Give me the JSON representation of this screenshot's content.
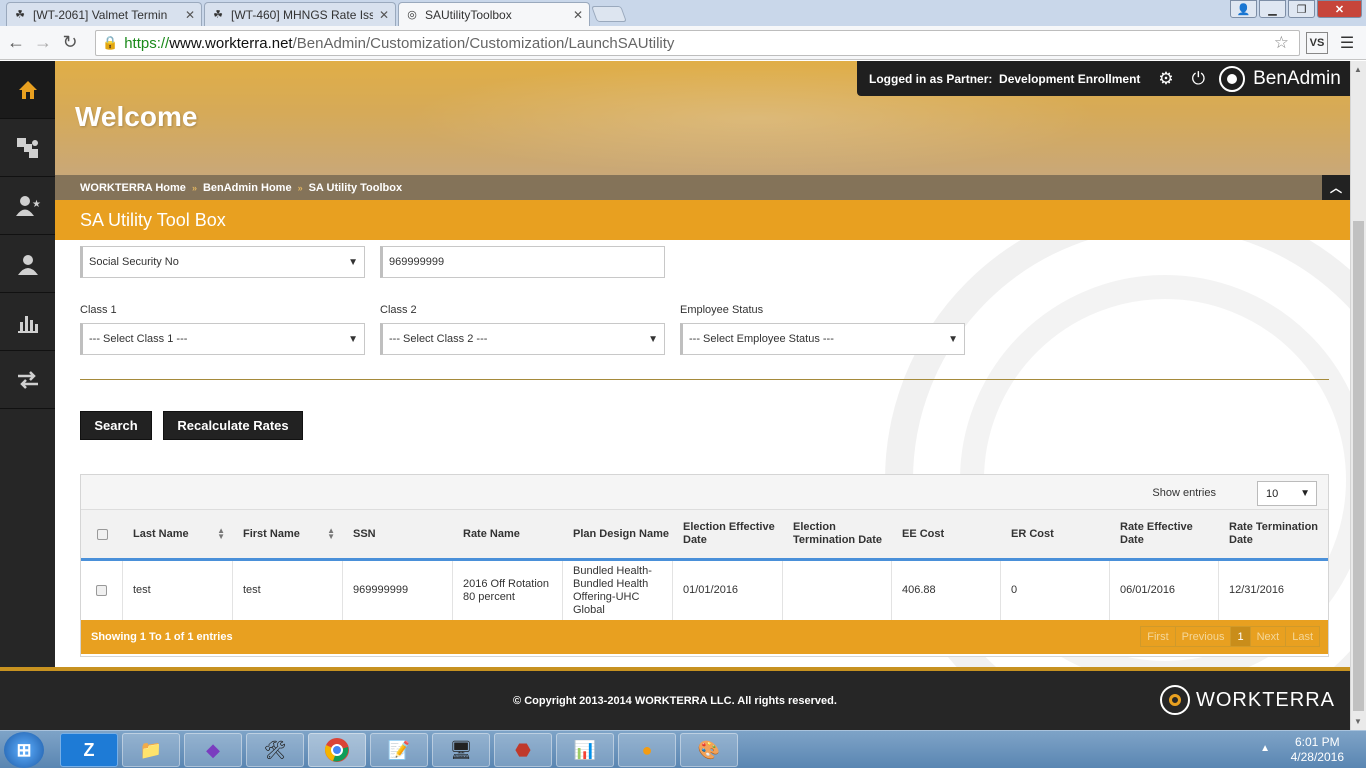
{
  "browser": {
    "tabs": [
      {
        "label": "[WT-2061] Valmet Termin",
        "active": false
      },
      {
        "label": "[WT-460] MHNGS Rate Iss",
        "active": false
      },
      {
        "label": "SAUtilityToolbox",
        "active": true
      }
    ],
    "url_https": "https://",
    "url_host": "www.workterra.net",
    "url_path": "/BenAdmin/Customization/Customization/LaunchSAUtility",
    "ext_label": "VS"
  },
  "header": {
    "welcome": "Welcome",
    "logged_in_prefix": "Logged in as",
    "partner_label": "Partner:",
    "partner_name": "Development Enrollment",
    "brand": "BenAdmin"
  },
  "breadcrumb": [
    "WORKTERRA Home",
    "BenAdmin Home",
    "SA Utility Toolbox"
  ],
  "section_title": "SA Utility Tool Box",
  "filters": {
    "search_type": "Social Security No",
    "search_value": "969999999",
    "class1_label": "Class 1",
    "class1_value": "--- Select Class 1 ---",
    "class2_label": "Class 2",
    "class2_value": "--- Select Class 2 ---",
    "status_label": "Employee Status",
    "status_value": "--- Select Employee Status ---"
  },
  "actions": {
    "search": "Search",
    "recalc": "Recalculate Rates"
  },
  "table": {
    "show_entries_label": "Show entries",
    "entries_value": "10",
    "columns": [
      "Last Name",
      "First Name",
      "SSN",
      "Rate Name",
      "Plan Design Name",
      "Election Effective Date",
      "Election Termination Date",
      "EE Cost",
      "ER Cost",
      "Rate Effective Date",
      "Rate Termination Date"
    ],
    "rows": [
      {
        "last": "test",
        "first": "test",
        "ssn": "969999999",
        "rate_name": "2016 Off Rotation 80 percent",
        "plan": "Bundled Health-Bundled Health Offering-UHC Global",
        "elec_eff": "01/01/2016",
        "elec_term": "",
        "ee_cost": "406.88",
        "er_cost": "0",
        "rate_eff": "06/01/2016",
        "rate_term": "12/31/2016"
      }
    ],
    "summary": "Showing 1 To 1 of 1 entries",
    "pager": {
      "first": "First",
      "previous": "Previous",
      "current": "1",
      "next": "Next",
      "last": "Last"
    }
  },
  "footer": {
    "copyright": "© Copyright 2013-2014 WORKTERRA LLC. All rights reserved.",
    "brand": "WORKTERRA"
  },
  "taskbar": {
    "time": "6:01 PM",
    "date": "4/28/2016"
  },
  "colors": {
    "accent": "#e8a020",
    "dark": "#262626",
    "link_blue": "#4a90d9"
  }
}
